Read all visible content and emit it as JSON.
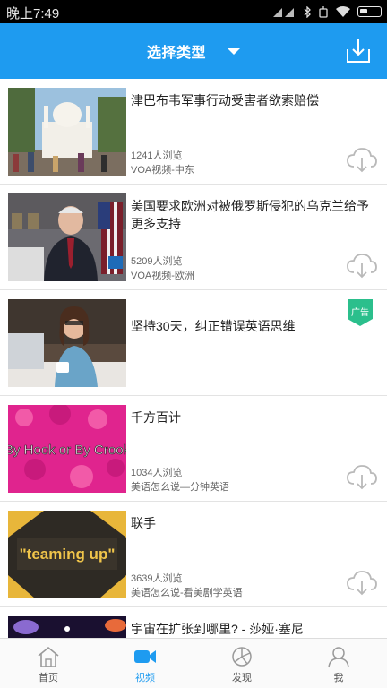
{
  "status_bar": {
    "time": "晚上7:49",
    "signal_text": "◥◥"
  },
  "header": {
    "title": "选择类型"
  },
  "items": [
    {
      "title": "津巴布韦军事行动受害者欲索赔偿",
      "views": "1241人浏览",
      "source": "VOA视频-中东",
      "thumbnail": "mosque-crowd",
      "downloadable": true
    },
    {
      "title": "美国要求欧洲对被俄罗斯侵犯的乌克兰给予更多支持",
      "views": "5209人浏览",
      "source": "VOA视频-欧洲",
      "thumbnail": "man-speaking-flags",
      "downloadable": true
    },
    {
      "title": "坚持30天，纠正错误英语思维",
      "ad_label": "广告",
      "thumbnail": "woman-laptop",
      "downloadable": false
    },
    {
      "title": "千方百计",
      "thumb_text": "By Hook or By Crook",
      "views": "1034人浏览",
      "source": "美语怎么说—分钟英语",
      "thumbnail": "pink-pattern-text",
      "downloadable": true
    },
    {
      "title": "联手",
      "thumb_text": "\"teaming up\"",
      "views": "3639人浏览",
      "source": "美语怎么说-看美剧学英语",
      "thumbnail": "dark-text",
      "downloadable": true
    },
    {
      "title": "宇宙在扩张到哪里? - 莎娅·塞尼",
      "thumbnail": "space-galaxy",
      "downloadable": false
    }
  ],
  "bottom_nav": [
    {
      "label": "首页",
      "icon": "home-icon",
      "active": false
    },
    {
      "label": "视频",
      "icon": "video-icon",
      "active": true
    },
    {
      "label": "发现",
      "icon": "discover-icon",
      "active": false
    },
    {
      "label": "我",
      "icon": "profile-icon",
      "active": false
    }
  ],
  "colors": {
    "accent": "#1e9bf0",
    "ad_badge": "#2bbf8c",
    "icon_gray": "#b9b9b9"
  }
}
